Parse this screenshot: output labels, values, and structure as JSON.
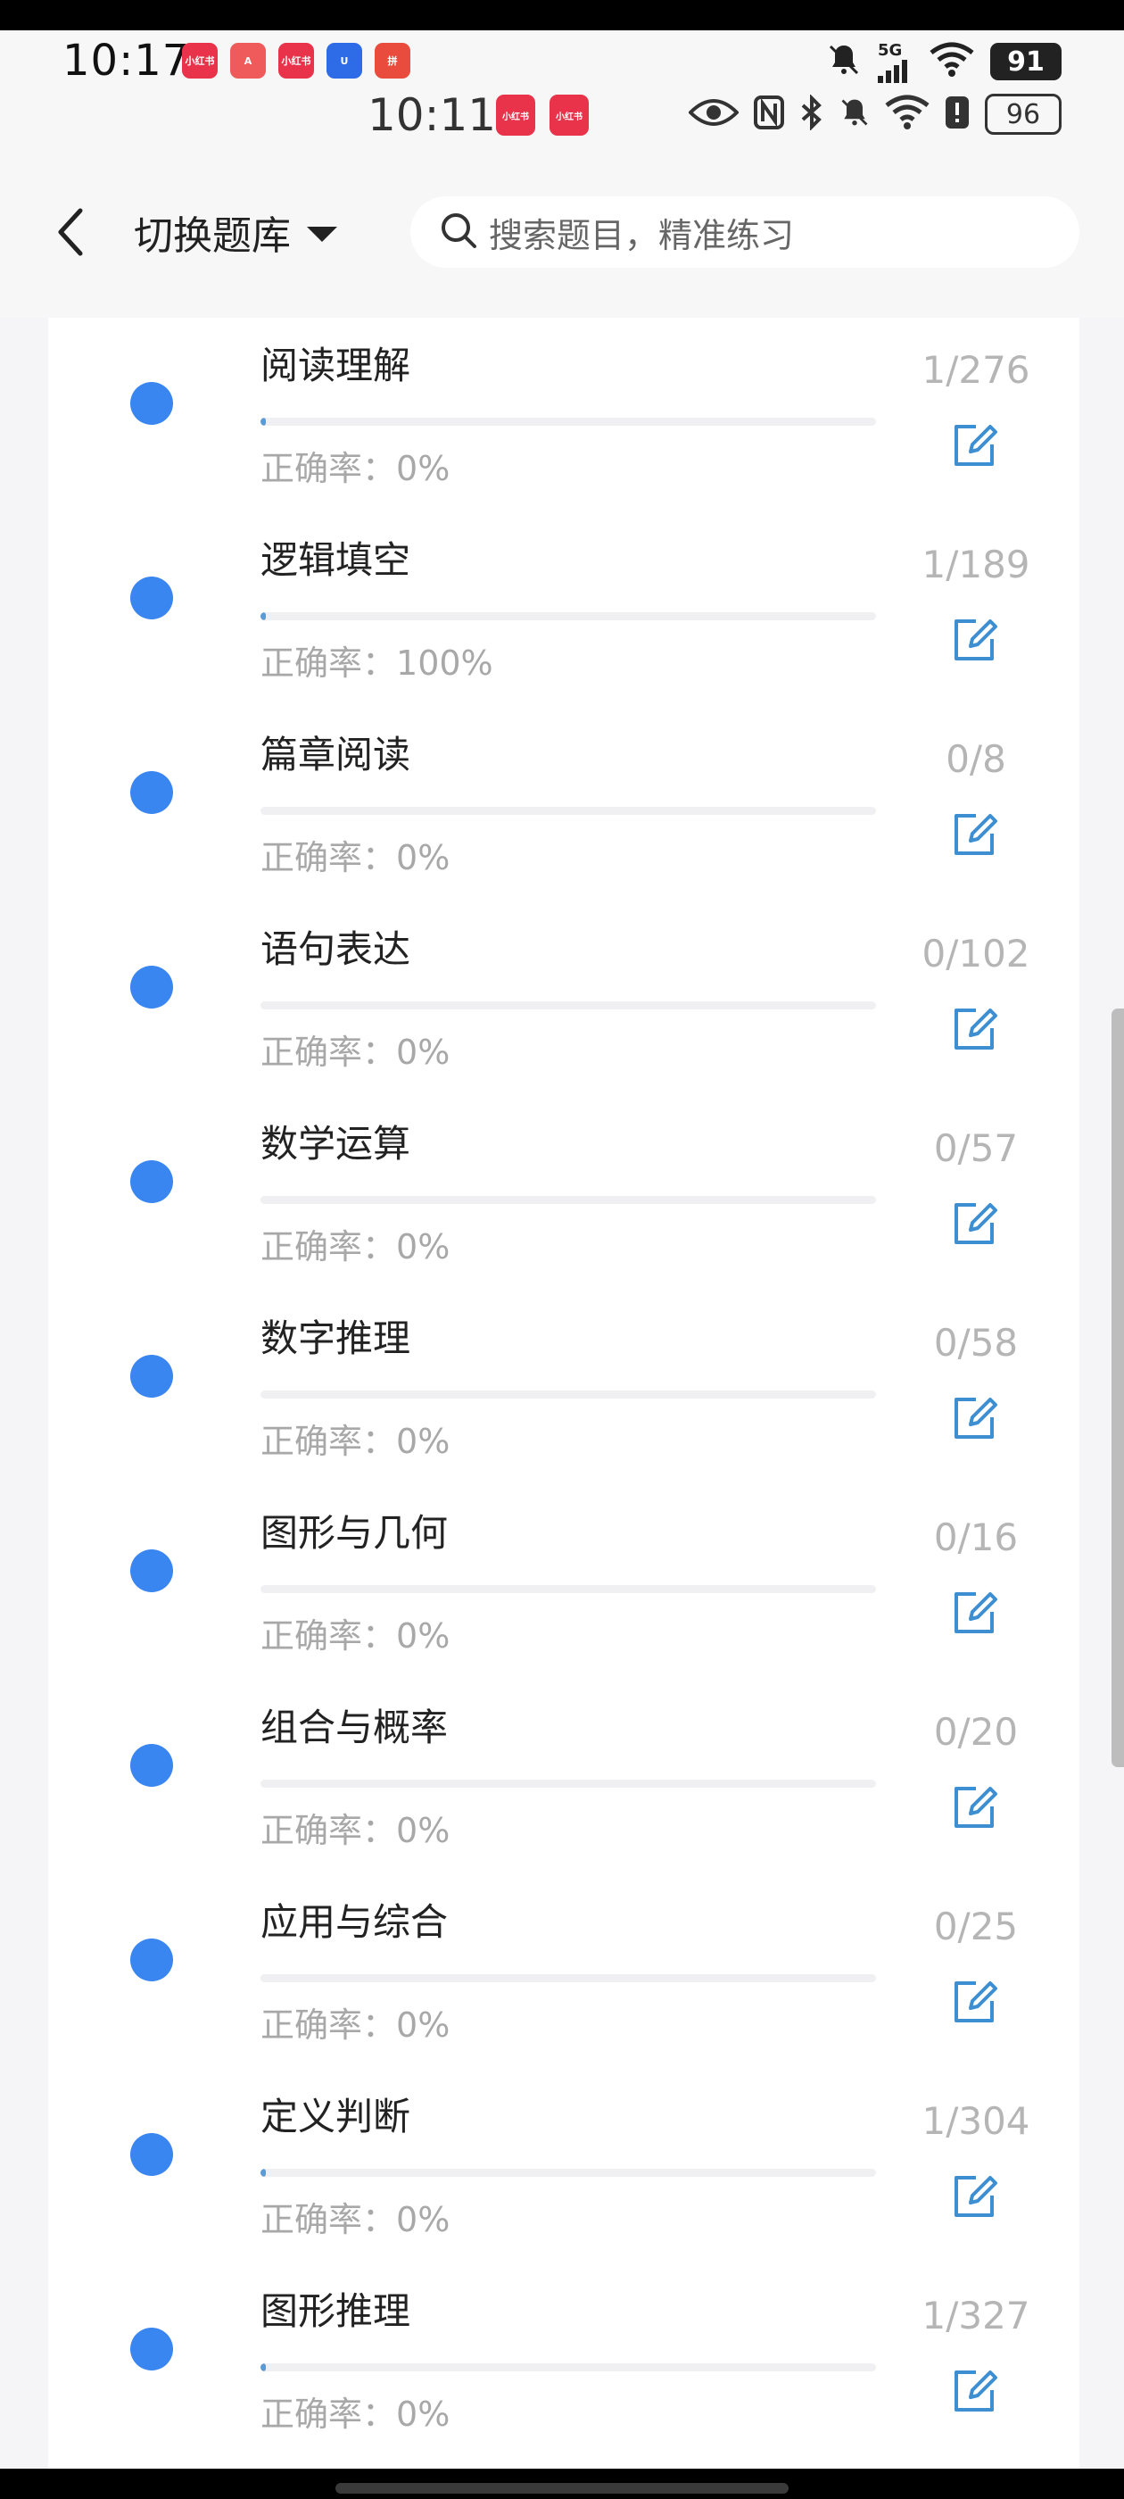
{
  "status_bar": {
    "time": "10:17",
    "network": "5G",
    "battery": "91",
    "apps": [
      {
        "label": "小红书",
        "color": "#e8334a"
      },
      {
        "label": "A",
        "color": "#ef5a5a"
      },
      {
        "label": "小红书",
        "color": "#e8334a"
      },
      {
        "label": "U",
        "color": "#2e6be6"
      },
      {
        "label": "拼",
        "color": "#e94c3c"
      }
    ]
  },
  "status_bar_2": {
    "time": "10:11",
    "battery": "96",
    "apps": [
      {
        "label": "小红书"
      },
      {
        "label": "小红书"
      }
    ]
  },
  "nav": {
    "switch_label": "切换题库",
    "search_placeholder": "搜索题目，精准练习"
  },
  "accuracy_prefix": "正确率：",
  "categories": [
    {
      "name": "阅读理解",
      "accuracy": "0%",
      "count": "1/276",
      "progress": 0.004
    },
    {
      "name": "逻辑填空",
      "accuracy": "100%",
      "count": "1/189",
      "progress": 0.006
    },
    {
      "name": "篇章阅读",
      "accuracy": "0%",
      "count": "0/8",
      "progress": 0
    },
    {
      "name": "语句表达",
      "accuracy": "0%",
      "count": "0/102",
      "progress": 0
    },
    {
      "name": "数学运算",
      "accuracy": "0%",
      "count": "0/57",
      "progress": 0
    },
    {
      "name": "数字推理",
      "accuracy": "0%",
      "count": "0/58",
      "progress": 0
    },
    {
      "name": "图形与几何",
      "accuracy": "0%",
      "count": "0/16",
      "progress": 0
    },
    {
      "name": "组合与概率",
      "accuracy": "0%",
      "count": "0/20",
      "progress": 0
    },
    {
      "name": "应用与综合",
      "accuracy": "0%",
      "count": "0/25",
      "progress": 0
    },
    {
      "name": "定义判断",
      "accuracy": "0%",
      "count": "1/304",
      "progress": 0.003
    },
    {
      "name": "图形推理",
      "accuracy": "0%",
      "count": "1/327",
      "progress": 0.003
    }
  ],
  "colors": {
    "dot": "#3a86f0",
    "progress": "#5b9bd5",
    "edit_icon": "#3d8fd1"
  }
}
